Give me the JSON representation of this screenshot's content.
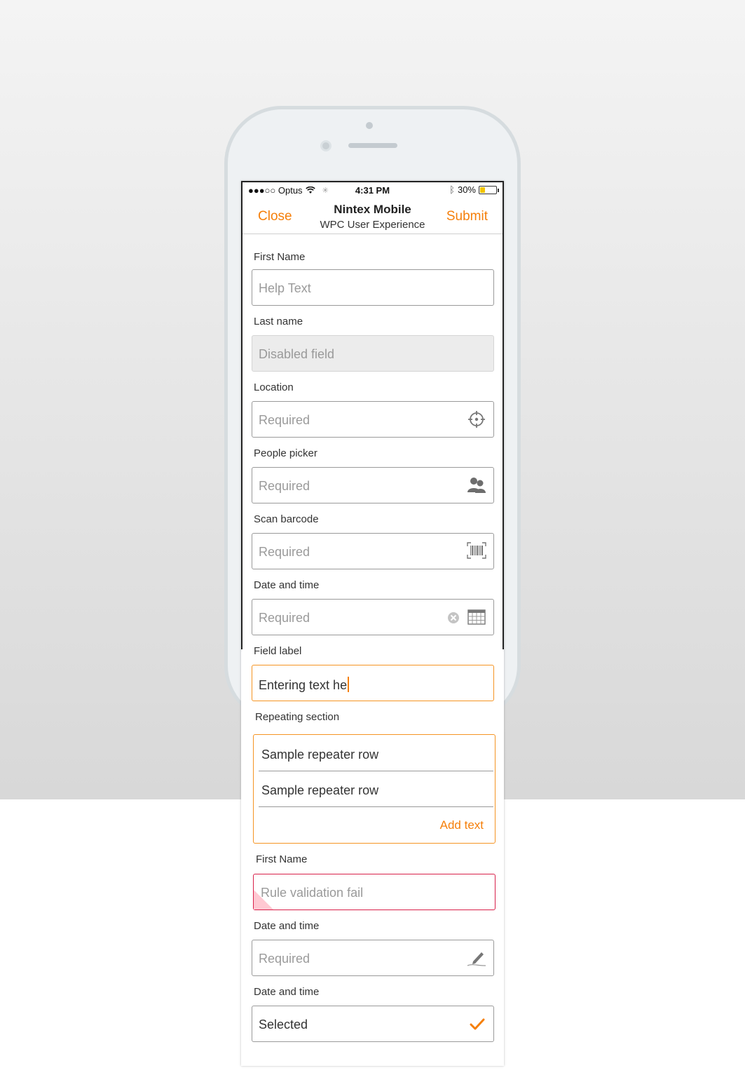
{
  "status_bar": {
    "carrier": "●●●○○ Optus",
    "time": "4:31 PM",
    "battery": "30%",
    "battery_level": 0.3
  },
  "nav": {
    "close_label": "Close",
    "title": "Nintex Mobile",
    "subtitle": "WPC User Experience",
    "submit_label": "Submit"
  },
  "form": {
    "first_name": {
      "label": "First Name",
      "placeholder": "Help Text"
    },
    "last_name": {
      "label": "Last name",
      "placeholder": "Disabled field"
    },
    "location": {
      "label": "Location",
      "placeholder": "Required",
      "icon": "crosshair-icon"
    },
    "people_picker": {
      "label": "People picker",
      "placeholder": "Required",
      "icon": "people-icon"
    },
    "scan_barcode": {
      "label": "Scan barcode",
      "placeholder": "Required",
      "icon": "barcode-icon"
    },
    "date_time_1": {
      "label": "Date and time",
      "placeholder": "Required",
      "icons": [
        "clear-icon",
        "calendar-icon"
      ]
    },
    "field_label": {
      "label": "Field label",
      "value": "Entering text he"
    },
    "repeating_section": {
      "label": "Repeating section",
      "rows": [
        "Sample repeater row",
        "Sample repeater row"
      ],
      "add_label": "Add text"
    },
    "first_name_2": {
      "label": "First Name",
      "placeholder": "Rule validation fail"
    },
    "date_time_2": {
      "label": "Date and time",
      "placeholder": "Required",
      "icon": "signature-pen-icon"
    },
    "date_time_3": {
      "label": "Date and time",
      "value": "Selected",
      "icon": "checkmark-icon"
    }
  },
  "colors": {
    "accent": "#f57f0a",
    "focus_border": "#f59423",
    "error_border": "#d8204a"
  }
}
